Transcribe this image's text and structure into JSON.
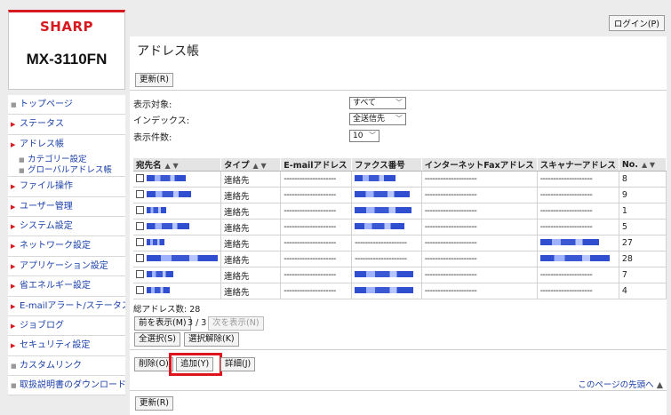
{
  "brand": {
    "logo_text": "SHARP",
    "model": "MX-3110FN"
  },
  "nav": {
    "items": [
      {
        "label": "トップページ",
        "marker": "square"
      },
      {
        "label": "ステータス",
        "marker": "triangle"
      },
      {
        "label": "アドレス帳",
        "marker": "triangle-down",
        "children": [
          {
            "label": "カテゴリー設定"
          },
          {
            "label": "グローバルアドレス帳"
          }
        ]
      },
      {
        "label": "ファイル操作",
        "marker": "triangle"
      },
      {
        "label": "ユーザー管理",
        "marker": "triangle"
      },
      {
        "label": "システム設定",
        "marker": "triangle"
      },
      {
        "label": "ネットワーク設定",
        "marker": "triangle"
      },
      {
        "label": "アプリケーション設定",
        "marker": "triangle"
      },
      {
        "label": "省エネルギー設定",
        "marker": "triangle"
      },
      {
        "label": "E-mailアラート/ステータス",
        "marker": "triangle"
      },
      {
        "label": "ジョブログ",
        "marker": "triangle"
      },
      {
        "label": "セキュリティ設定",
        "marker": "triangle"
      },
      {
        "label": "カスタムリンク",
        "marker": "square"
      },
      {
        "label": "取扱説明書のダウンロード",
        "marker": "square"
      }
    ]
  },
  "header": {
    "login_label": "ログイン(P)"
  },
  "page": {
    "title": "アドレス帳"
  },
  "toolbar": {
    "refresh_label": "更新(R)",
    "prev_label": "前を表示(M)",
    "page_info": "3 / 3",
    "next_label": "次を表示(N)",
    "select_all_label": "全選択(S)",
    "deselect_label": "選択解除(K)",
    "delete_label": "削除(O)",
    "add_label": "追加(Y)",
    "detail_label": "詳細(J)"
  },
  "filters": {
    "display_target": {
      "label": "表示対象:",
      "value": "すべて"
    },
    "index": {
      "label": "インデックス:",
      "value": "全送信先"
    },
    "count": {
      "label": "表示件数:",
      "value": "10"
    }
  },
  "table": {
    "headers": [
      "宛先名",
      "タイプ",
      "E-mailアドレス",
      "ファクス番号",
      "インターネットFaxアドレス",
      "スキャナーアドレス",
      "No."
    ],
    "rows": [
      {
        "type": "連絡先",
        "email": "--------------------",
        "ifax": "--------------------",
        "scanner": "--------------------",
        "no": "8"
      },
      {
        "type": "連絡先",
        "email": "--------------------",
        "ifax": "--------------------",
        "scanner": "--------------------",
        "no": "9"
      },
      {
        "type": "連絡先",
        "email": "--------------------",
        "ifax": "--------------------",
        "scanner": "--------------------",
        "no": "1"
      },
      {
        "type": "連絡先",
        "email": "--------------------",
        "ifax": "--------------------",
        "scanner": "--------------------",
        "no": "5"
      },
      {
        "type": "連絡先",
        "email": "--------------------",
        "fax": "--------------------",
        "ifax": "--------------------",
        "no": "27"
      },
      {
        "type": "連絡先",
        "email": "--------------------",
        "fax": "--------------------",
        "ifax": "--------------------",
        "no": "28"
      },
      {
        "type": "連絡先",
        "email": "--------------------",
        "ifax": "--------------------",
        "scanner": "--------------------",
        "no": "7"
      },
      {
        "type": "連絡先",
        "email": "--------------------",
        "ifax": "--------------------",
        "scanner": "--------------------",
        "no": "4"
      }
    ]
  },
  "summary": {
    "total_label": "総アドレス数:",
    "total_count": "28"
  },
  "footer": {
    "to_top_label": "このページの先頭へ"
  },
  "colors": {
    "brand_red": "#d71920",
    "link_blue": "#1a3fa8",
    "highlight_red": "#e0141e"
  }
}
